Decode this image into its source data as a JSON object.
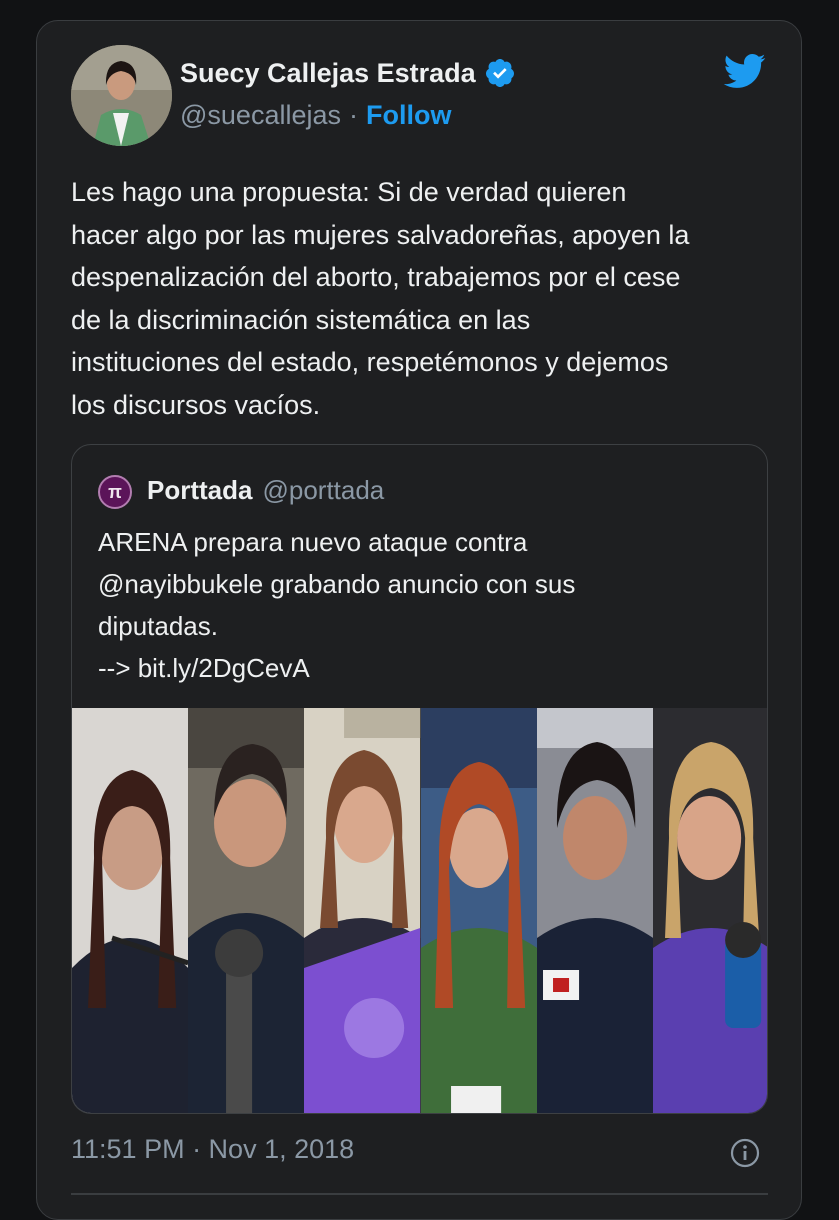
{
  "author": {
    "name": "Suecy Callejas Estrada",
    "handle": "@suecallejas",
    "separator": "·",
    "follow_label": "Follow"
  },
  "icons": {
    "verified": "verified-badge-icon",
    "logo": "twitter-bird-icon",
    "info": "info-icon"
  },
  "colors": {
    "accent": "#1d9bf0",
    "background": "#1e1f21",
    "text": "#eef0f1",
    "muted": "#8b98a5"
  },
  "tweet": {
    "text": "Les hago una propuesta: Si de verdad quieren\nhacer algo por las mujeres salvadoreñas, apoyen la\ndespenalización del aborto, trabajemos por el cese\nde la discriminación sistemática en las\ninstituciones del estado, respetémonos y dejemos\nlos discursos vacíos.",
    "timestamp": "11:51 PM · Nov 1, 2018"
  },
  "quoted": {
    "avatar_glyph": "π",
    "name": "Porttada",
    "handle": "@porttada",
    "text": "ARENA prepara nuevo ataque contra\n@nayibbukele grabando anuncio con sus\ndiputadas.\n--> bit.ly/2DgCevA"
  }
}
